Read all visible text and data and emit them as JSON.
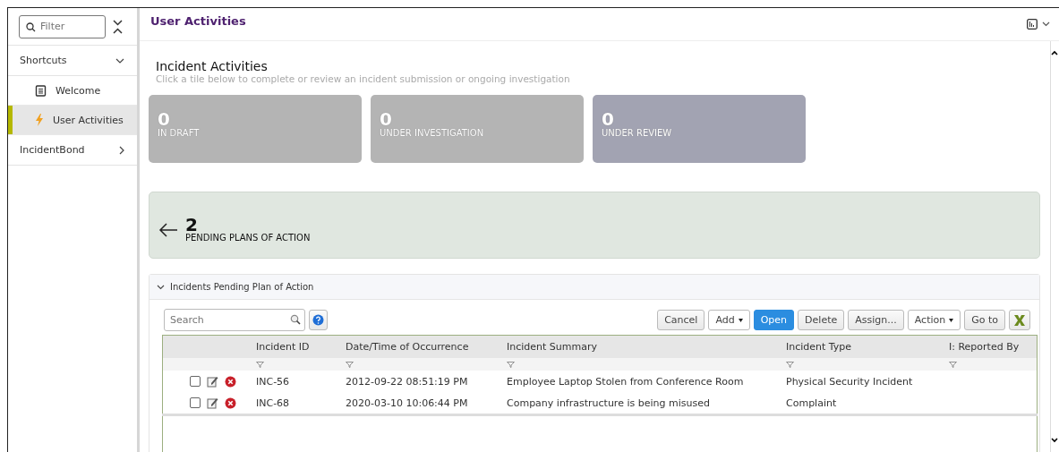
{
  "sidebar": {
    "filter": {
      "placeholder": "Filter"
    },
    "sections": [
      {
        "label": "Shortcuts",
        "expanded": true,
        "items": [
          {
            "label": "Welcome",
            "kind": "document",
            "selected": false
          },
          {
            "label": "User Activities",
            "kind": "bolt",
            "selected": true
          }
        ]
      },
      {
        "label": "IncidentBond",
        "expanded": false
      }
    ]
  },
  "header": {
    "title": "User Activities"
  },
  "activities": {
    "title": "Incident Activities",
    "subtitle": "Click a tile below to complete or review an incident submission or ongoing investigation",
    "tiles": [
      {
        "count": "0",
        "label": "IN DRAFT",
        "selected": false
      },
      {
        "count": "0",
        "label": "UNDER INVESTIGATION",
        "selected": false
      },
      {
        "count": "0",
        "label": "UNDER REVIEW",
        "selected": true
      }
    ]
  },
  "banner": {
    "count": "2",
    "label": "PENDING PLANS OF ACTION"
  },
  "panel": {
    "title": "Incidents Pending Plan of Action",
    "expanded": true,
    "search": {
      "placeholder": "Search"
    },
    "buttons": [
      {
        "label": "Cancel",
        "kind": "plain"
      },
      {
        "label": "Add",
        "kind": "dropdown"
      },
      {
        "label": "Open",
        "kind": "primary"
      },
      {
        "label": "Delete",
        "kind": "plain"
      },
      {
        "label": "Assign...",
        "kind": "plain"
      },
      {
        "label": "Action",
        "kind": "dropdown"
      },
      {
        "label": "Go to",
        "kind": "plain"
      }
    ],
    "columns": [
      "Incident ID",
      "Date/Time of Occurrence",
      "Incident Summary",
      "Incident Type",
      "I: Reported By"
    ],
    "rows": [
      {
        "checked": false,
        "cells": [
          "INC-56",
          "2012-09-22 08:51:19 PM",
          "Employee Laptop Stolen from Conference Room",
          "Physical Security Incident",
          ""
        ]
      },
      {
        "checked": false,
        "cells": [
          "INC-68",
          "2020-03-10 10:06:44 PM",
          "Company infrastructure is being misused",
          "Complaint",
          ""
        ]
      }
    ]
  }
}
